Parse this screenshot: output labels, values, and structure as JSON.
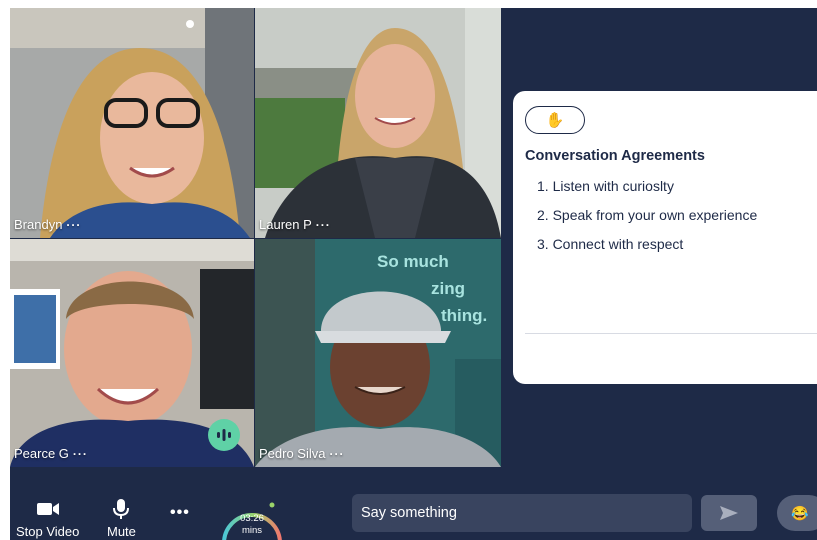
{
  "participants": [
    {
      "name": "Brandyn",
      "more": "···"
    },
    {
      "name": "Lauren P",
      "more": "···"
    },
    {
      "name": "Pearce G",
      "more": "···"
    },
    {
      "name": "Pedro Silva",
      "more": "···"
    }
  ],
  "tile4_sign": {
    "line1": "So much",
    "line2": "zing",
    "line3": "thing."
  },
  "agreements": {
    "hand_emoji": "✋",
    "title": "Conversation Agreements",
    "items": [
      "1. Listen with curioslty",
      "2. Speak from your own experience",
      "3. Connect with respect"
    ]
  },
  "toolbar": {
    "stop_video_label": "Stop Video",
    "mute_label": "Mute",
    "more_label": "•••",
    "timer_value": "03:26",
    "timer_unit": "mins",
    "chat_placeholder": "Say something",
    "emoji": "😂"
  },
  "colors": {
    "background": "#1e2a47",
    "speaking": "#5fd1a6",
    "timer_start": "#4cc7d6",
    "timer_end": "#f0786e"
  },
  "icons": [
    "video-camera-icon",
    "microphone-icon",
    "more-icon",
    "send-icon",
    "speaking-icon",
    "hand-icon"
  ]
}
